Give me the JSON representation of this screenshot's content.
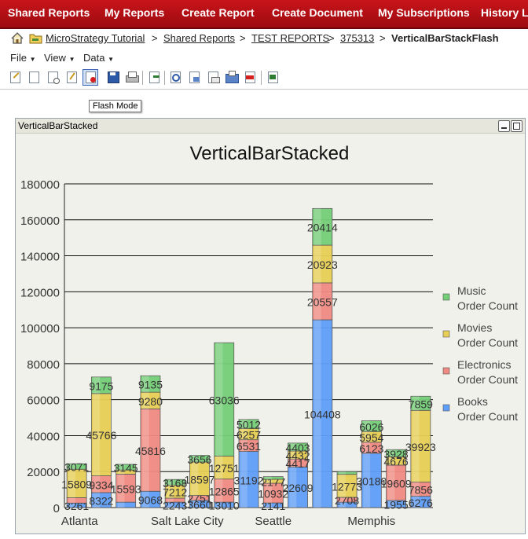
{
  "topnav": {
    "items": [
      "Shared Reports",
      "My Reports",
      "Create Report",
      "Create Document",
      "My Subscriptions",
      "History Li"
    ]
  },
  "breadcrumb": {
    "items": [
      "MicroStrategy Tutorial",
      "Shared Reports",
      "TEST REPORTS",
      "375313"
    ],
    "separator": ">",
    "current": "VerticalBarStackFlash"
  },
  "menu": {
    "items": [
      "File",
      "View",
      "Data"
    ]
  },
  "toolbar": {
    "icons": [
      "design-mode-icon",
      "grid-view-icon",
      "graph-view-icon",
      "grid-graph-view-icon",
      "flash-mode-icon",
      "save-icon",
      "print-icon",
      "export-icon",
      "refresh-icon",
      "pdf-icon",
      "email-icon",
      "subscribe-icon",
      "pdf-export-icon",
      "add-to-history-icon"
    ],
    "tooltip": "Flash Mode"
  },
  "panel": {
    "title": "VerticalBarStacked"
  },
  "colors": {
    "nav": "#b50f15",
    "books": "#5f9ef8",
    "electronics": "#f08a82",
    "movies": "#e7cf55",
    "music": "#74cf78"
  },
  "chart_data": {
    "type": "bar",
    "stacked": true,
    "title": "VerticalBarStacked",
    "ylim": [
      0,
      180000
    ],
    "yticks": [
      0,
      20000,
      40000,
      60000,
      80000,
      100000,
      120000,
      140000,
      160000,
      180000
    ],
    "x_group_labels": [
      "Atlanta",
      "Salt Lake City",
      "Seattle",
      "Memphis"
    ],
    "legend_position": "right",
    "grid": true,
    "series": [
      {
        "name": "Books Order Count",
        "values": [
          2500,
          8322,
          3000,
          9068,
          3000,
          4000,
          3010,
          31192,
          2600,
          22609,
          104408,
          3000,
          30180,
          4000,
          6276
        ]
      },
      {
        "name": "Electronics Order Count",
        "values": [
          3000,
          9334,
          15593,
          45816,
          2248,
          2751,
          12865,
          6531,
          10932,
          4417,
          20557,
          2708,
          6123,
          19609,
          7856
        ]
      },
      {
        "name": "Movies Order Count",
        "values": [
          15809,
          45766,
          2300,
          9280,
          7212,
          18597,
          12751,
          6257,
          2177,
          4432,
          20923,
          12773,
          5954,
          4676,
          39923
        ]
      },
      {
        "name": "Music Order Count",
        "values": [
          3071,
          9175,
          3145,
          9135,
          3168,
          3656,
          63036,
          5012,
          1500,
          4403,
          20414,
          1500,
          6026,
          3928,
          7859
        ]
      }
    ],
    "data_labels": {
      "Books": [
        "3261",
        "8322",
        "",
        "9068",
        "2243",
        "3660",
        "13010",
        "31192",
        "2141",
        "22609",
        "104408",
        "",
        "30180",
        "1955",
        "6276"
      ],
      "Electronics": [
        "",
        "9334",
        "15593",
        "45816",
        "",
        "2751",
        "12865",
        "6531",
        "10932",
        "4417",
        "20557",
        "2708",
        "6123",
        "19609",
        "7856"
      ],
      "Movies": [
        "15809",
        "45766",
        "",
        "9280",
        "7212",
        "18597",
        "12751",
        "6257",
        "2177",
        "4432",
        "20923",
        "12773",
        "5954",
        "4676",
        "39923"
      ],
      "Music": [
        "3071",
        "9175",
        "3145",
        "9135",
        "3168",
        "3656",
        "63036",
        "5012",
        "",
        "4403",
        "20414",
        "",
        "6026",
        "3928",
        "7859"
      ]
    }
  }
}
